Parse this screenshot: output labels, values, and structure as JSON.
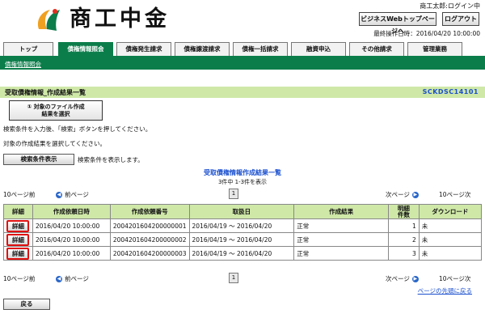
{
  "header": {
    "brand": "商工中金",
    "user_line": "商工太郎:ログイン中",
    "web_top_button": "ビジネスWebトップページへ",
    "logout_button": "ログアウト",
    "last_operation": "最終操作日時：2016/04/20 10:00:00"
  },
  "tabs": [
    {
      "label": "トップ",
      "active": false
    },
    {
      "label": "債権情報照会",
      "active": true
    },
    {
      "label": "債権発生請求",
      "active": false
    },
    {
      "label": "債権譲渡請求",
      "active": false
    },
    {
      "label": "債権一括請求",
      "active": false
    },
    {
      "label": "融資申込",
      "active": false
    },
    {
      "label": "その他請求",
      "active": false
    },
    {
      "label": "管理業務",
      "active": false
    }
  ],
  "subnav": {
    "link": "債権情報照会"
  },
  "titlebar": {
    "title": "受取債権情報_作成結果一覧",
    "code": "SCKDSC14101"
  },
  "step": {
    "line1": "① 対象のファイル作成",
    "line2": "結果を選択"
  },
  "instructions": {
    "line1": "検索条件を入力後、「検索」ボタンを押してください。",
    "line2": "対象の作成結果を選択してください。"
  },
  "search_conditions": {
    "button": "検索条件表示",
    "note": "検索条件を表示します。"
  },
  "results": {
    "title": "受取債権情報作成結果一覧",
    "count": "3件中 1-3件を表示"
  },
  "pager": {
    "prev10": "10ページ前",
    "prev": "前ページ",
    "page": "1",
    "next": "次ページ",
    "next10": "10ページ次"
  },
  "table": {
    "headers": {
      "detail": "詳細",
      "created": "作成依頼日時",
      "reqno": "作成依頼番号",
      "period": "取扱日",
      "result": "作成結果",
      "count_l1": "明細",
      "count_l2": "件数",
      "download": "ダウンロード"
    },
    "detail_label": "詳細",
    "rows": [
      {
        "created": "2016/04/20 10:00:00",
        "reqno": "2004201604200000001",
        "period": "2016/04/19 ～ 2016/04/20",
        "result": "正常",
        "count": "1",
        "download": "未"
      },
      {
        "created": "2016/04/20 10:00:00",
        "reqno": "2004201604200000002",
        "period": "2016/04/19 ～ 2016/04/20",
        "result": "正常",
        "count": "2",
        "download": "未"
      },
      {
        "created": "2016/04/20 10:00:00",
        "reqno": "2004201604200000003",
        "period": "2016/04/19 ～ 2016/04/20",
        "result": "正常",
        "count": "3",
        "download": "未"
      }
    ]
  },
  "page_top": "ページの先頭に戻る",
  "back_button": "戻る",
  "colors": {
    "brand_green": "#0b7d4a",
    "title_bg": "#cfe8a8",
    "link_blue": "#1a4fcf",
    "highlight_red": "#e01010"
  }
}
